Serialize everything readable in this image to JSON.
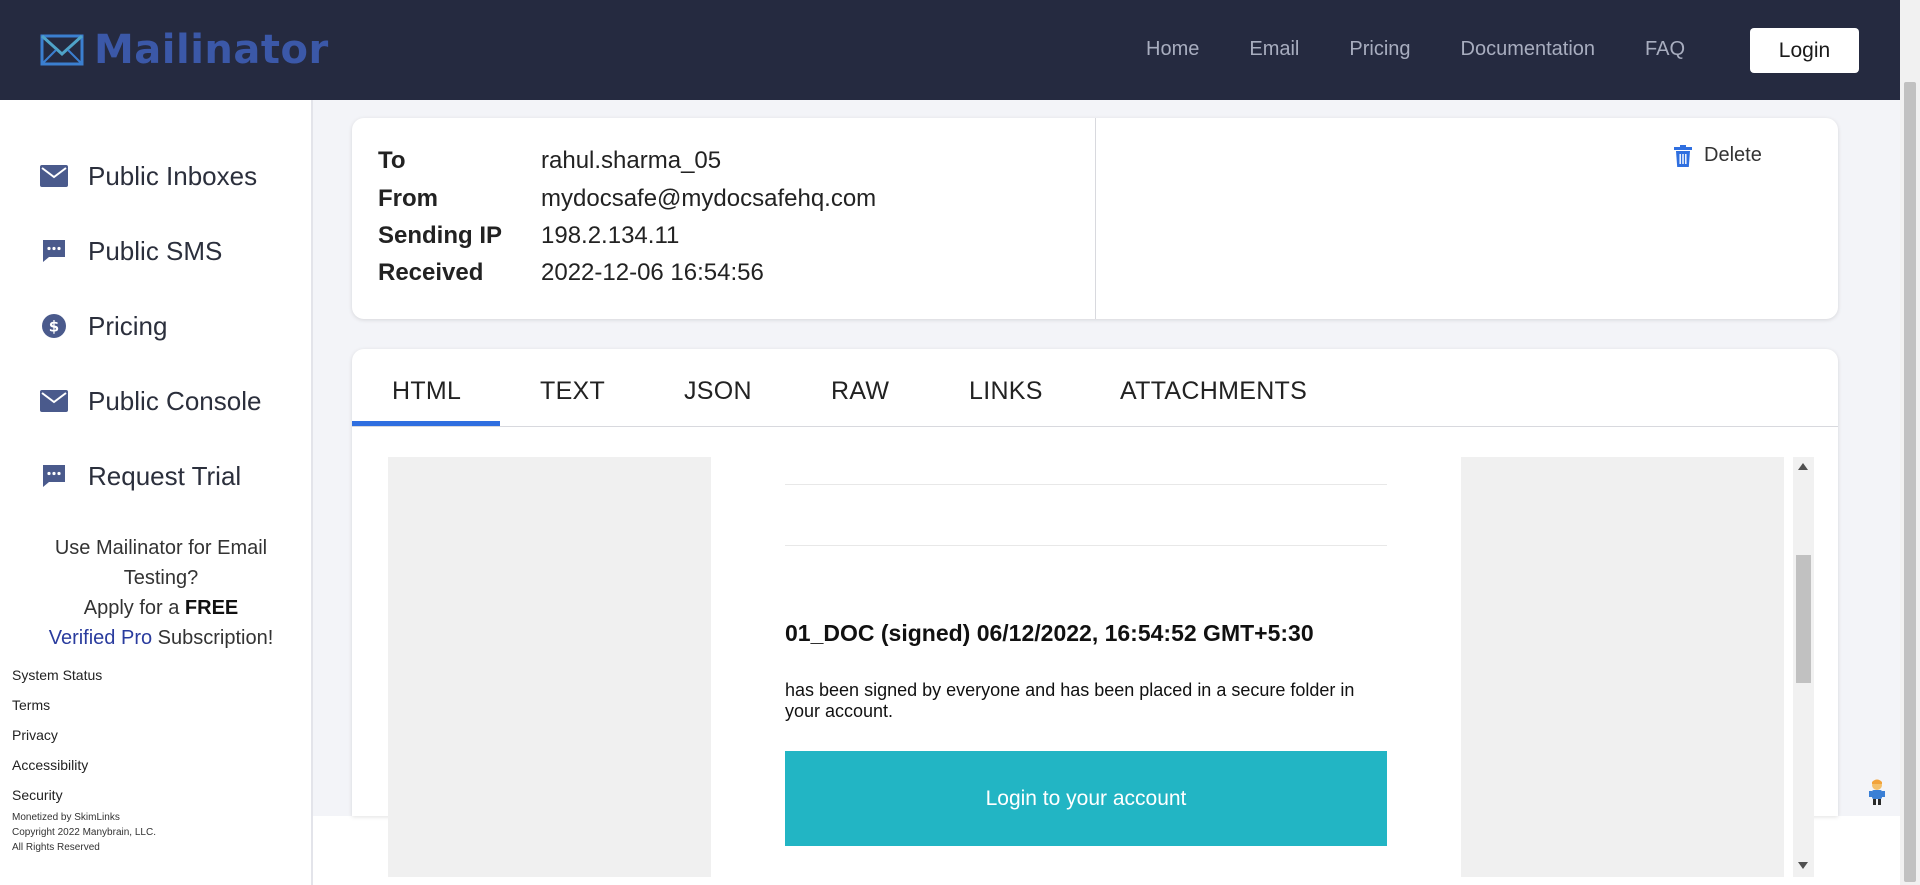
{
  "brand": {
    "name": "Mailinator"
  },
  "nav": {
    "links": [
      "Home",
      "Email",
      "Pricing",
      "Documentation",
      "FAQ"
    ],
    "login_label": "Login"
  },
  "sidebar": {
    "items": [
      {
        "label": "Public Inboxes",
        "icon": "mail-icon"
      },
      {
        "label": "Public SMS",
        "icon": "sms-icon"
      },
      {
        "label": "Pricing",
        "icon": "dollar-icon"
      },
      {
        "label": "Public Console",
        "icon": "mail-icon"
      },
      {
        "label": "Request Trial",
        "icon": "sms-icon"
      }
    ],
    "promo": {
      "line1": "Use Mailinator for Email Testing?",
      "apply": "Apply for a ",
      "free": "FREE",
      "verified": "Verified Pro",
      "subscription": " Subscription!"
    },
    "footer_links": [
      "System Status",
      "Terms",
      "Privacy",
      "Accessibility",
      "Security"
    ],
    "fine_print": [
      "Monetized by SkimLinks",
      "Copyright 2022 Manybrain, LLC.",
      "All Rights Reserved"
    ]
  },
  "message": {
    "to_label": "To",
    "to": "rahul.sharma_05",
    "from_label": "From",
    "from": "mydocsafe@mydocsafehq.com",
    "ip_label": "Sending IP",
    "ip": "198.2.134.11",
    "received_label": "Received",
    "received": "2022-12-06 16:54:56",
    "delete_label": "Delete"
  },
  "tabs": [
    "HTML",
    "TEXT",
    "JSON",
    "RAW",
    "LINKS",
    "ATTACHMENTS"
  ],
  "active_tab": "HTML",
  "email": {
    "title": "01_DOC (signed) 06/12/2022, 16:54:52 GMT+5:30",
    "body": "has been signed by everyone and has been placed in a secure folder in your account.",
    "cta": "Login to your account"
  },
  "colors": {
    "topbar": "#252a40",
    "brand": "#3b58a8",
    "tab_indicator": "#2f6fe0",
    "cta": "#22b5c4",
    "sidebar_icon": "#4a5a8c",
    "delete_icon": "#2f6fe0"
  }
}
